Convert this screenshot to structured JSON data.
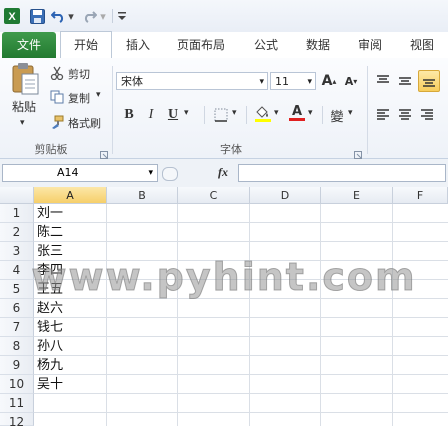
{
  "qat": {
    "dropdown_glyph": "▾"
  },
  "tabs": {
    "items": [
      "文件",
      "开始",
      "插入",
      "页面布局",
      "公式",
      "数据",
      "审阅",
      "视图"
    ],
    "active_index": 1
  },
  "ribbon": {
    "clipboard": {
      "paste_label": "粘贴",
      "cut_label": "剪切",
      "copy_label": "复制",
      "format_painter_label": "格式刷",
      "group_label": "剪贴板"
    },
    "font": {
      "font_name": "宋体",
      "font_size": "11",
      "grow_glyph": "A",
      "shrink_glyph": "A",
      "bold_glyph": "B",
      "italic_glyph": "I",
      "underline_glyph": "U",
      "font_color_glyph": "A",
      "phonetic_glyph": "變",
      "group_label": "字体"
    }
  },
  "formula_bar": {
    "name_box": "A14",
    "fx_label": "fx",
    "content": ""
  },
  "grid": {
    "columns": [
      "A",
      "B",
      "C",
      "D",
      "E",
      "F"
    ],
    "selected_column": "A",
    "rows": [
      "1",
      "2",
      "3",
      "4",
      "5",
      "6",
      "7",
      "8",
      "9",
      "10",
      "11",
      "12"
    ],
    "selected_row": "",
    "cells_col_a": [
      "刘一",
      "陈二",
      "张三",
      "李四",
      "王五",
      "赵六",
      "钱七",
      "孙八",
      "杨九",
      "吴十",
      "",
      ""
    ]
  },
  "watermark": "www.pyhint.com",
  "colors": {
    "file_tab": "#2f8a3c",
    "accent_highlight": "#f6cf6a"
  }
}
